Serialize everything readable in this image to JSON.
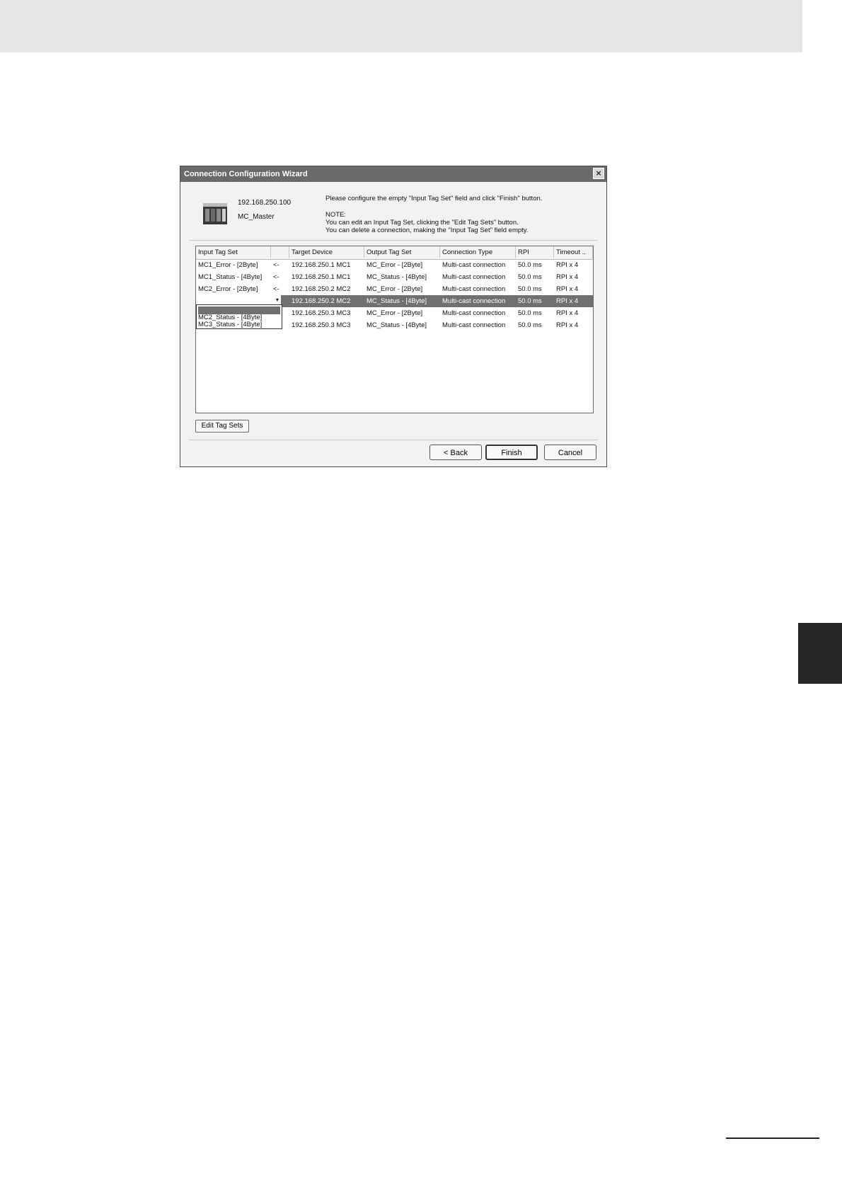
{
  "dialog": {
    "title": "Connection Configuration Wizard",
    "close_glyph": "×",
    "device": {
      "ip": "192.168.250.100",
      "name": "MC_Master"
    },
    "instructions": {
      "line1": "Please configure the empty \"Input Tag Set\" field and click \"Finish\" button.",
      "note_label": "NOTE:",
      "note1": "You can edit an Input Tag Set, clicking the \"Edit Tag Sets\" button.",
      "note2": "You can delete a connection, making the \"Input Tag Set\" field empty."
    },
    "columns": [
      "Input Tag Set",
      "",
      "Target Device",
      "Output Tag Set",
      "Connection Type",
      "RPI",
      "Timeout .."
    ],
    "rows": [
      {
        "input": "MC1_Error - [2Byte]",
        "dir": "<-",
        "target": "192.168.250.1 MC1",
        "output": "MC_Error - [2Byte]",
        "type": "Multi-cast connection",
        "rpi": "50.0 ms",
        "timeout": "RPI x 4"
      },
      {
        "input": "MC1_Status - [4Byte]",
        "dir": "<-",
        "target": "192.168.250.1 MC1",
        "output": "MC_Status - [4Byte]",
        "type": "Multi-cast connection",
        "rpi": "50.0 ms",
        "timeout": "RPI x 4"
      },
      {
        "input": "MC2_Error - [2Byte]",
        "dir": "<-",
        "target": "192.168.250.2 MC2",
        "output": "MC_Error - [2Byte]",
        "type": "Multi-cast connection",
        "rpi": "50.0 ms",
        "timeout": "RPI x 4"
      },
      {
        "input": "",
        "dir": "",
        "target": "192.168.250.2 MC2",
        "output": "MC_Status - [4Byte]",
        "type": "Multi-cast connection",
        "rpi": "50.0 ms",
        "timeout": "RPI x 4"
      },
      {
        "input": "",
        "dir": "",
        "target": "192.168.250.3 MC3",
        "output": "MC_Error - [2Byte]",
        "type": "Multi-cast connection",
        "rpi": "50.0 ms",
        "timeout": "RPI x 4"
      },
      {
        "input": "",
        "dir": "",
        "target": "192.168.250.3 MC3",
        "output": "MC_Status - [4Byte]",
        "type": "Multi-cast connection",
        "rpi": "50.0 ms",
        "timeout": "RPI x 4"
      }
    ],
    "dropdown": {
      "arrow_glyph": "▾",
      "options": [
        "",
        "MC2_Status - [4Byte]",
        "MC3_Status - [4Byte]"
      ]
    },
    "buttons": {
      "edit_tag_sets": "Edit Tag Sets",
      "back": "< Back",
      "finish": "Finish",
      "cancel": "Cancel"
    }
  }
}
